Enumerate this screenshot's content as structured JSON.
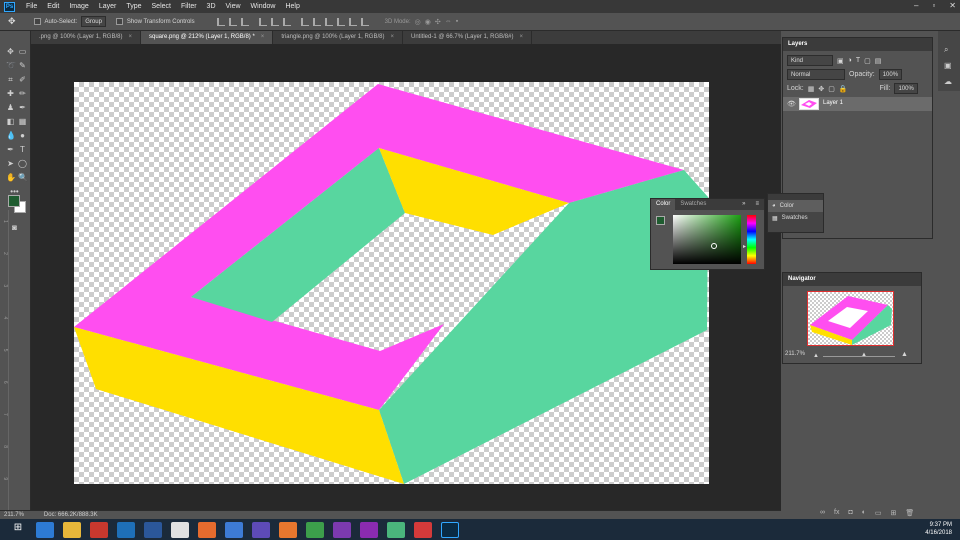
{
  "app": {
    "logo": "Ps"
  },
  "menu": [
    "File",
    "Edit",
    "Image",
    "Layer",
    "Type",
    "Select",
    "Filter",
    "3D",
    "View",
    "Window",
    "Help"
  ],
  "options": {
    "auto_select_label": "Auto-Select:",
    "auto_select_value": "Group",
    "transform_label": "Show Transform Controls",
    "mode_3d": "3D Mode:"
  },
  "tabs": [
    {
      "label": ".png @ 100% (Layer 1, RGB/8)",
      "active": false
    },
    {
      "label": "square.png @ 212% (Layer 1, RGB/8) *",
      "active": true
    },
    {
      "label": "triangle.png @ 100% (Layer 1, RGB/8)",
      "active": false
    },
    {
      "label": "Untitled-1 @ 66.7% (Layer 1, RGB/8#)",
      "active": false
    }
  ],
  "tab_close": "×",
  "ruler_v": [
    "1",
    "2",
    "3",
    "4",
    "5",
    "6",
    "7",
    "8",
    "9"
  ],
  "status": {
    "zoom": "211.7%",
    "doc": "Doc: 666.2K/888.3K"
  },
  "colors": {
    "pink": "#ff4ef0",
    "teal": "#58d69f",
    "yellow": "#ffdf00",
    "fg": "#1f5c30",
    "bg": "#ffffff"
  },
  "layers": {
    "title": "Layers",
    "kind": "Kind",
    "blend": "Normal",
    "opacity_label": "Opacity:",
    "opacity": "100%",
    "lock_label": "Lock:",
    "fill_label": "Fill:",
    "fill": "100%",
    "layer_name": "Layer 1"
  },
  "color_panel": {
    "tab_color": "Color",
    "tab_swatches": "Swatches"
  },
  "mini_panel": {
    "color": "Color",
    "swatches": "Swatches"
  },
  "navigator": {
    "title": "Navigator",
    "zoom": "211.7%"
  },
  "clock": {
    "time": "9:37 PM",
    "date": "4/16/2018"
  }
}
